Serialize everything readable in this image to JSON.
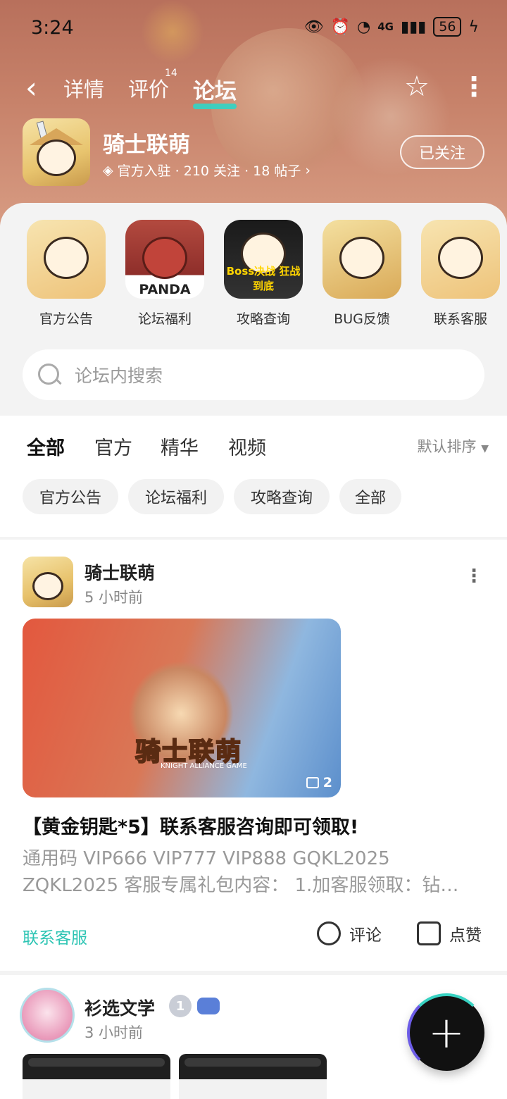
{
  "status_bar": {
    "time": "3:24",
    "network": "4G",
    "battery": "56"
  },
  "nav": {
    "tabs": [
      {
        "label": "详情"
      },
      {
        "label": "评价",
        "badge": "14"
      },
      {
        "label": "论坛"
      }
    ],
    "active_tab": "论坛"
  },
  "game": {
    "name": "骑士联萌",
    "meta": "官方入驻 · 210 关注 · 18 帖子",
    "follow_label": "已关注"
  },
  "shortcuts": [
    {
      "label": "官方公告"
    },
    {
      "label": "论坛福利",
      "image_text": "PANDA"
    },
    {
      "label": "攻略查询",
      "image_text": "Boss决战 狂战到底"
    },
    {
      "label": "BUG反馈"
    },
    {
      "label": "联系客服"
    }
  ],
  "search": {
    "placeholder": "论坛内搜索"
  },
  "filters": {
    "tabs": [
      "全部",
      "官方",
      "精华",
      "视频"
    ],
    "active_tab": "全部",
    "sort_label": "默认排序",
    "chips": [
      "官方公告",
      "论坛福利",
      "攻略查询",
      "全部"
    ]
  },
  "posts": [
    {
      "author": "骑士联萌",
      "time": "5 小时前",
      "image_count": "2",
      "banner_logo": "骑士联萌",
      "banner_sub": "KNIGHT ALLIANCE GAME",
      "title": "【黄金钥匙*5】联系客服咨询即可领取!",
      "body": "通用码 VIP666 VIP777 VIP888 GQKL2025 ZQKL2025 客服专属礼包内容： 1.加客服领取：钻…",
      "tag": "联系客服",
      "comment_label": "评论",
      "like_label": "点赞"
    },
    {
      "author": "衫选文学",
      "level": "1",
      "time": "3 小时前"
    }
  ],
  "colors": {
    "accent": "#38d2c2",
    "tag": "#2cc4b3"
  }
}
